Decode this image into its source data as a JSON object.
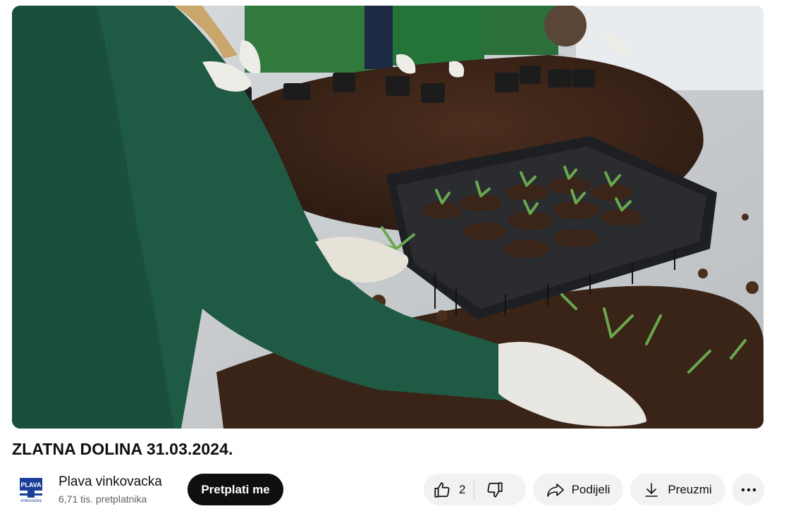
{
  "video": {
    "title": "ZLATNA DOLINA 31.03.2024."
  },
  "channel": {
    "name": "Plava vinkovacka",
    "subscribers": "6,71 tis. pretplatnika",
    "logo_text_top": "PLAVA",
    "logo_text_bottom": "vinkovačka",
    "logo_colors": {
      "blue": "#1a3f9a",
      "white": "#ffffff"
    }
  },
  "actions": {
    "subscribe_label": "Pretplati me",
    "like_count": "2",
    "share_label": "Podijeli",
    "download_label": "Preuzmi"
  },
  "icons": {
    "like": "thumbs-up-icon",
    "dislike": "thumbs-down-icon",
    "share": "share-arrow-icon",
    "download": "download-icon",
    "more": "more-horizontal-icon"
  },
  "theme": {
    "subscribe_bg": "#0f0f0f",
    "pill_bg": "#f2f2f2",
    "secondary_text": "#606060"
  }
}
